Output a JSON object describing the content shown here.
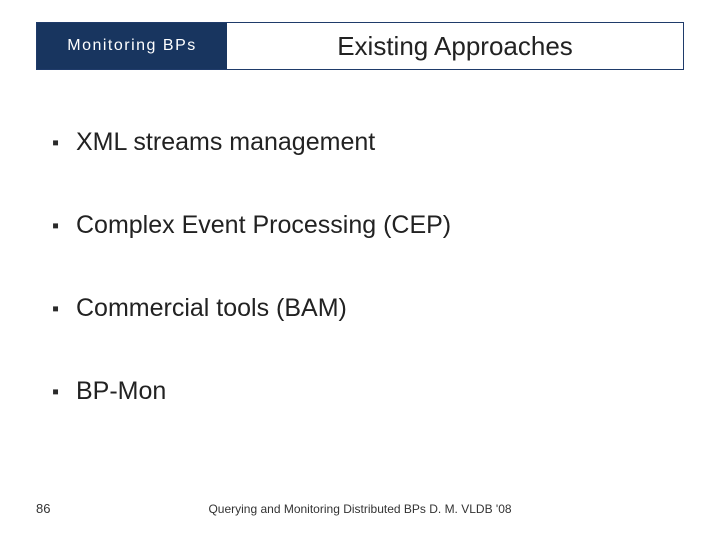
{
  "title_bar": {
    "tab": "Monitoring  BPs",
    "main": "Existing Approaches"
  },
  "bullets": [
    "XML streams management",
    "Complex Event Processing (CEP)",
    "Commercial tools (BAM)",
    "BP-Mon"
  ],
  "page_number": "86",
  "footer": "Querying and Monitoring Distributed BPs D. M. VLDB '08"
}
